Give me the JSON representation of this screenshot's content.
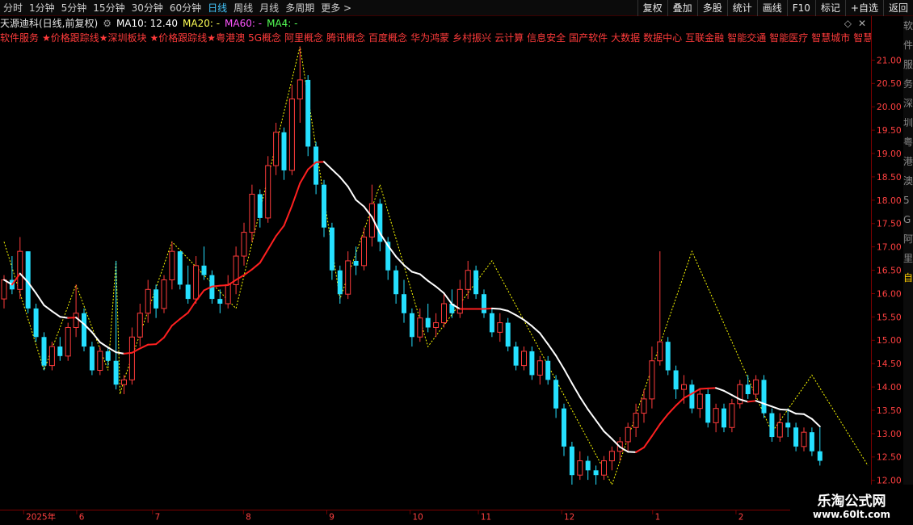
{
  "toolbar": {
    "period_tabs": [
      "分时",
      "1分钟",
      "5分钟",
      "15分钟",
      "30分钟",
      "60分钟",
      "日线",
      "周线",
      "月线",
      "多周期",
      "更多 >"
    ],
    "active_tab": "日线",
    "right_tools": [
      "复权",
      "叠加",
      "多股",
      "统计",
      "画线",
      "F10",
      "标记",
      "+自选",
      "返回"
    ]
  },
  "infoline": {
    "stock_name": "天源迪科(日线,前复权)",
    "ma10": "MA10: 12.40",
    "ma20": "MA20: -",
    "ma60": "MA60: -",
    "ma4": "MA4: -"
  },
  "concepts": [
    "软件服务",
    "★价格跟踪线★深圳板块",
    "★价格跟踪线★粤港澳",
    "5G概念",
    "阿里概念",
    "腾讯概念",
    "百度概念",
    "华为鸿蒙",
    "乡村振兴",
    "云计算",
    "信息安全",
    "国产软件",
    "大数据",
    "数据中心",
    "互联金融",
    "智能交通",
    "智能医疗",
    "智慧城市",
    "智慧政务"
  ],
  "watermark": {
    "title": "乐淘公式网",
    "url": "www.60lt.com"
  },
  "colors": {
    "up": "#ff3b3b",
    "down": "#25e0ff",
    "ma_up": "#ff2020",
    "ma_down": "#ffffff",
    "zigzag": "#ffff00",
    "axis": "#7a0000"
  },
  "chart_data": {
    "type": "candlestick",
    "ylim": [
      12.0,
      21.5
    ],
    "y_ticks": [
      "12.00",
      "12.50",
      "13.00",
      "13.50",
      "14.00",
      "14.50",
      "15.00",
      "15.50",
      "16.00",
      "16.50",
      "17.00",
      "17.50",
      "18.00",
      "18.50",
      "19.00",
      "19.50",
      "20.00",
      "20.50",
      "21.00"
    ],
    "x_labels": [
      {
        "index": 0,
        "label": "2025年"
      },
      {
        "index": 7,
        "label": "6"
      },
      {
        "index": 17,
        "label": "7"
      },
      {
        "index": 29,
        "label": "8"
      },
      {
        "index": 40,
        "label": "9"
      },
      {
        "index": 51,
        "label": "10"
      },
      {
        "index": 60,
        "label": "11"
      },
      {
        "index": 71,
        "label": "12"
      },
      {
        "index": 83,
        "label": "1"
      },
      {
        "index": 94,
        "label": "2"
      }
    ],
    "right_strip_labels": [
      "软",
      "件",
      "服",
      "务",
      "深",
      "圳",
      "粤",
      "港",
      "澳",
      "5",
      "G",
      "阿",
      "里",
      "自"
    ],
    "zigzag_points": [
      [
        0,
        17.1
      ],
      [
        5,
        14.4
      ],
      [
        9,
        16.2
      ],
      [
        13,
        14.4
      ],
      [
        14,
        16.7
      ],
      [
        14.5,
        13.9
      ],
      [
        15,
        14.2
      ],
      [
        21,
        17.1
      ],
      [
        29,
        15.7
      ],
      [
        37,
        21.2
      ],
      [
        42,
        15.9
      ],
      [
        47,
        18.3
      ],
      [
        53,
        14.9
      ],
      [
        61,
        16.7
      ],
      [
        76,
        12.0
      ],
      [
        86,
        16.9
      ],
      [
        96,
        13.1
      ],
      [
        101,
        14.3
      ],
      [
        108,
        12.4
      ]
    ],
    "ohlc": [
      [
        15.9,
        16.4,
        15.7,
        16.3
      ],
      [
        16.3,
        16.8,
        16.0,
        16.1
      ],
      [
        16.1,
        17.2,
        15.9,
        16.9
      ],
      [
        16.9,
        16.9,
        15.6,
        15.7
      ],
      [
        15.7,
        15.8,
        15.0,
        15.1
      ],
      [
        15.1,
        15.2,
        14.4,
        14.5
      ],
      [
        14.5,
        15.0,
        14.4,
        14.9
      ],
      [
        14.9,
        15.1,
        14.6,
        14.7
      ],
      [
        14.7,
        15.4,
        14.6,
        15.3
      ],
      [
        15.3,
        16.2,
        15.1,
        15.6
      ],
      [
        15.6,
        15.7,
        14.8,
        14.9
      ],
      [
        14.9,
        15.0,
        14.3,
        14.4
      ],
      [
        14.4,
        14.9,
        14.3,
        14.8
      ],
      [
        14.8,
        14.9,
        14.5,
        14.6
      ],
      [
        14.6,
        16.7,
        14.0,
        14.1
      ],
      [
        14.1,
        14.3,
        13.9,
        14.2
      ],
      [
        14.2,
        15.3,
        14.1,
        15.1
      ],
      [
        15.1,
        15.8,
        14.9,
        15.6
      ],
      [
        15.6,
        16.3,
        15.4,
        16.1
      ],
      [
        16.1,
        16.2,
        15.5,
        15.7
      ],
      [
        15.7,
        16.4,
        15.6,
        16.3
      ],
      [
        16.3,
        17.1,
        16.1,
        16.9
      ],
      [
        16.9,
        16.9,
        16.1,
        16.2
      ],
      [
        16.2,
        16.6,
        15.8,
        15.9
      ],
      [
        15.9,
        16.8,
        15.8,
        16.6
      ],
      [
        16.6,
        17.0,
        16.3,
        16.4
      ],
      [
        16.4,
        16.5,
        15.8,
        15.9
      ],
      [
        15.9,
        16.1,
        15.6,
        15.8
      ],
      [
        15.8,
        16.4,
        15.7,
        16.2
      ],
      [
        16.2,
        17.0,
        16.0,
        16.8
      ],
      [
        16.8,
        17.5,
        16.6,
        17.3
      ],
      [
        17.3,
        18.3,
        17.1,
        18.1
      ],
      [
        18.1,
        18.2,
        17.4,
        17.6
      ],
      [
        17.6,
        18.9,
        17.5,
        18.7
      ],
      [
        18.7,
        19.6,
        18.5,
        19.4
      ],
      [
        19.4,
        19.5,
        18.4,
        18.6
      ],
      [
        18.6,
        20.4,
        18.5,
        20.1
      ],
      [
        20.1,
        21.2,
        19.6,
        20.5
      ],
      [
        20.5,
        20.6,
        18.9,
        19.1
      ],
      [
        19.1,
        19.2,
        18.1,
        18.3
      ],
      [
        18.3,
        18.4,
        17.2,
        17.4
      ],
      [
        17.4,
        17.5,
        16.3,
        16.5
      ],
      [
        16.5,
        16.6,
        15.8,
        16.0
      ],
      [
        16.0,
        16.9,
        15.9,
        16.7
      ],
      [
        16.7,
        17.0,
        16.4,
        16.6
      ],
      [
        16.6,
        17.4,
        16.5,
        17.2
      ],
      [
        17.2,
        18.3,
        17.0,
        17.9
      ],
      [
        17.9,
        18.0,
        16.9,
        17.1
      ],
      [
        17.1,
        17.2,
        16.3,
        16.5
      ],
      [
        16.5,
        16.6,
        15.8,
        16.0
      ],
      [
        16.0,
        16.3,
        15.4,
        15.6
      ],
      [
        15.6,
        15.7,
        14.9,
        15.1
      ],
      [
        15.1,
        15.7,
        15.0,
        15.5
      ],
      [
        15.5,
        15.8,
        15.2,
        15.3
      ],
      [
        15.3,
        15.6,
        15.1,
        15.4
      ],
      [
        15.4,
        16.0,
        15.3,
        15.8
      ],
      [
        15.8,
        16.1,
        15.5,
        15.6
      ],
      [
        15.6,
        16.3,
        15.5,
        16.1
      ],
      [
        16.1,
        16.7,
        15.9,
        16.5
      ],
      [
        16.5,
        16.6,
        15.9,
        16.0
      ],
      [
        16.0,
        16.1,
        15.5,
        15.6
      ],
      [
        15.6,
        15.7,
        15.1,
        15.2
      ],
      [
        15.2,
        15.6,
        15.0,
        15.4
      ],
      [
        15.4,
        15.5,
        14.8,
        14.9
      ],
      [
        14.9,
        15.0,
        14.4,
        14.5
      ],
      [
        14.5,
        14.9,
        14.4,
        14.8
      ],
      [
        14.8,
        14.9,
        14.2,
        14.3
      ],
      [
        14.3,
        14.7,
        14.1,
        14.6
      ],
      [
        14.6,
        14.7,
        14.1,
        14.2
      ],
      [
        14.2,
        14.3,
        13.4,
        13.6
      ],
      [
        13.6,
        13.7,
        12.6,
        12.8
      ],
      [
        12.8,
        12.9,
        12.0,
        12.2
      ],
      [
        12.2,
        12.7,
        12.1,
        12.5
      ],
      [
        12.5,
        12.6,
        12.1,
        12.3
      ],
      [
        12.3,
        12.4,
        12.0,
        12.2
      ],
      [
        12.2,
        12.6,
        12.1,
        12.5
      ],
      [
        12.5,
        12.8,
        12.3,
        12.7
      ],
      [
        12.7,
        13.0,
        12.5,
        12.9
      ],
      [
        12.9,
        13.3,
        12.7,
        13.2
      ],
      [
        13.2,
        13.7,
        13.0,
        13.5
      ],
      [
        13.5,
        14.0,
        13.3,
        13.8
      ],
      [
        13.8,
        14.9,
        13.6,
        14.6
      ],
      [
        14.6,
        16.9,
        14.5,
        15.0
      ],
      [
        15.0,
        15.1,
        14.3,
        14.4
      ],
      [
        14.4,
        14.5,
        13.8,
        14.0
      ],
      [
        14.0,
        14.3,
        13.7,
        14.1
      ],
      [
        14.1,
        14.2,
        13.5,
        13.6
      ],
      [
        13.6,
        14.0,
        13.4,
        13.9
      ],
      [
        13.9,
        14.0,
        13.2,
        13.3
      ],
      [
        13.3,
        13.7,
        13.1,
        13.6
      ],
      [
        13.6,
        13.7,
        13.1,
        13.2
      ],
      [
        13.2,
        13.8,
        13.1,
        13.7
      ],
      [
        13.7,
        14.2,
        13.6,
        14.1
      ],
      [
        14.1,
        14.3,
        13.8,
        13.9
      ],
      [
        13.9,
        14.3,
        13.8,
        14.2
      ],
      [
        14.2,
        14.3,
        13.4,
        13.5
      ],
      [
        13.5,
        13.6,
        12.9,
        13.0
      ],
      [
        13.0,
        13.5,
        12.9,
        13.3
      ],
      [
        13.3,
        13.6,
        13.0,
        13.2
      ],
      [
        13.2,
        13.3,
        12.7,
        12.8
      ],
      [
        12.8,
        13.2,
        12.7,
        13.1
      ],
      [
        13.1,
        13.2,
        12.6,
        12.7
      ],
      [
        12.7,
        13.2,
        12.4,
        12.5
      ]
    ]
  }
}
